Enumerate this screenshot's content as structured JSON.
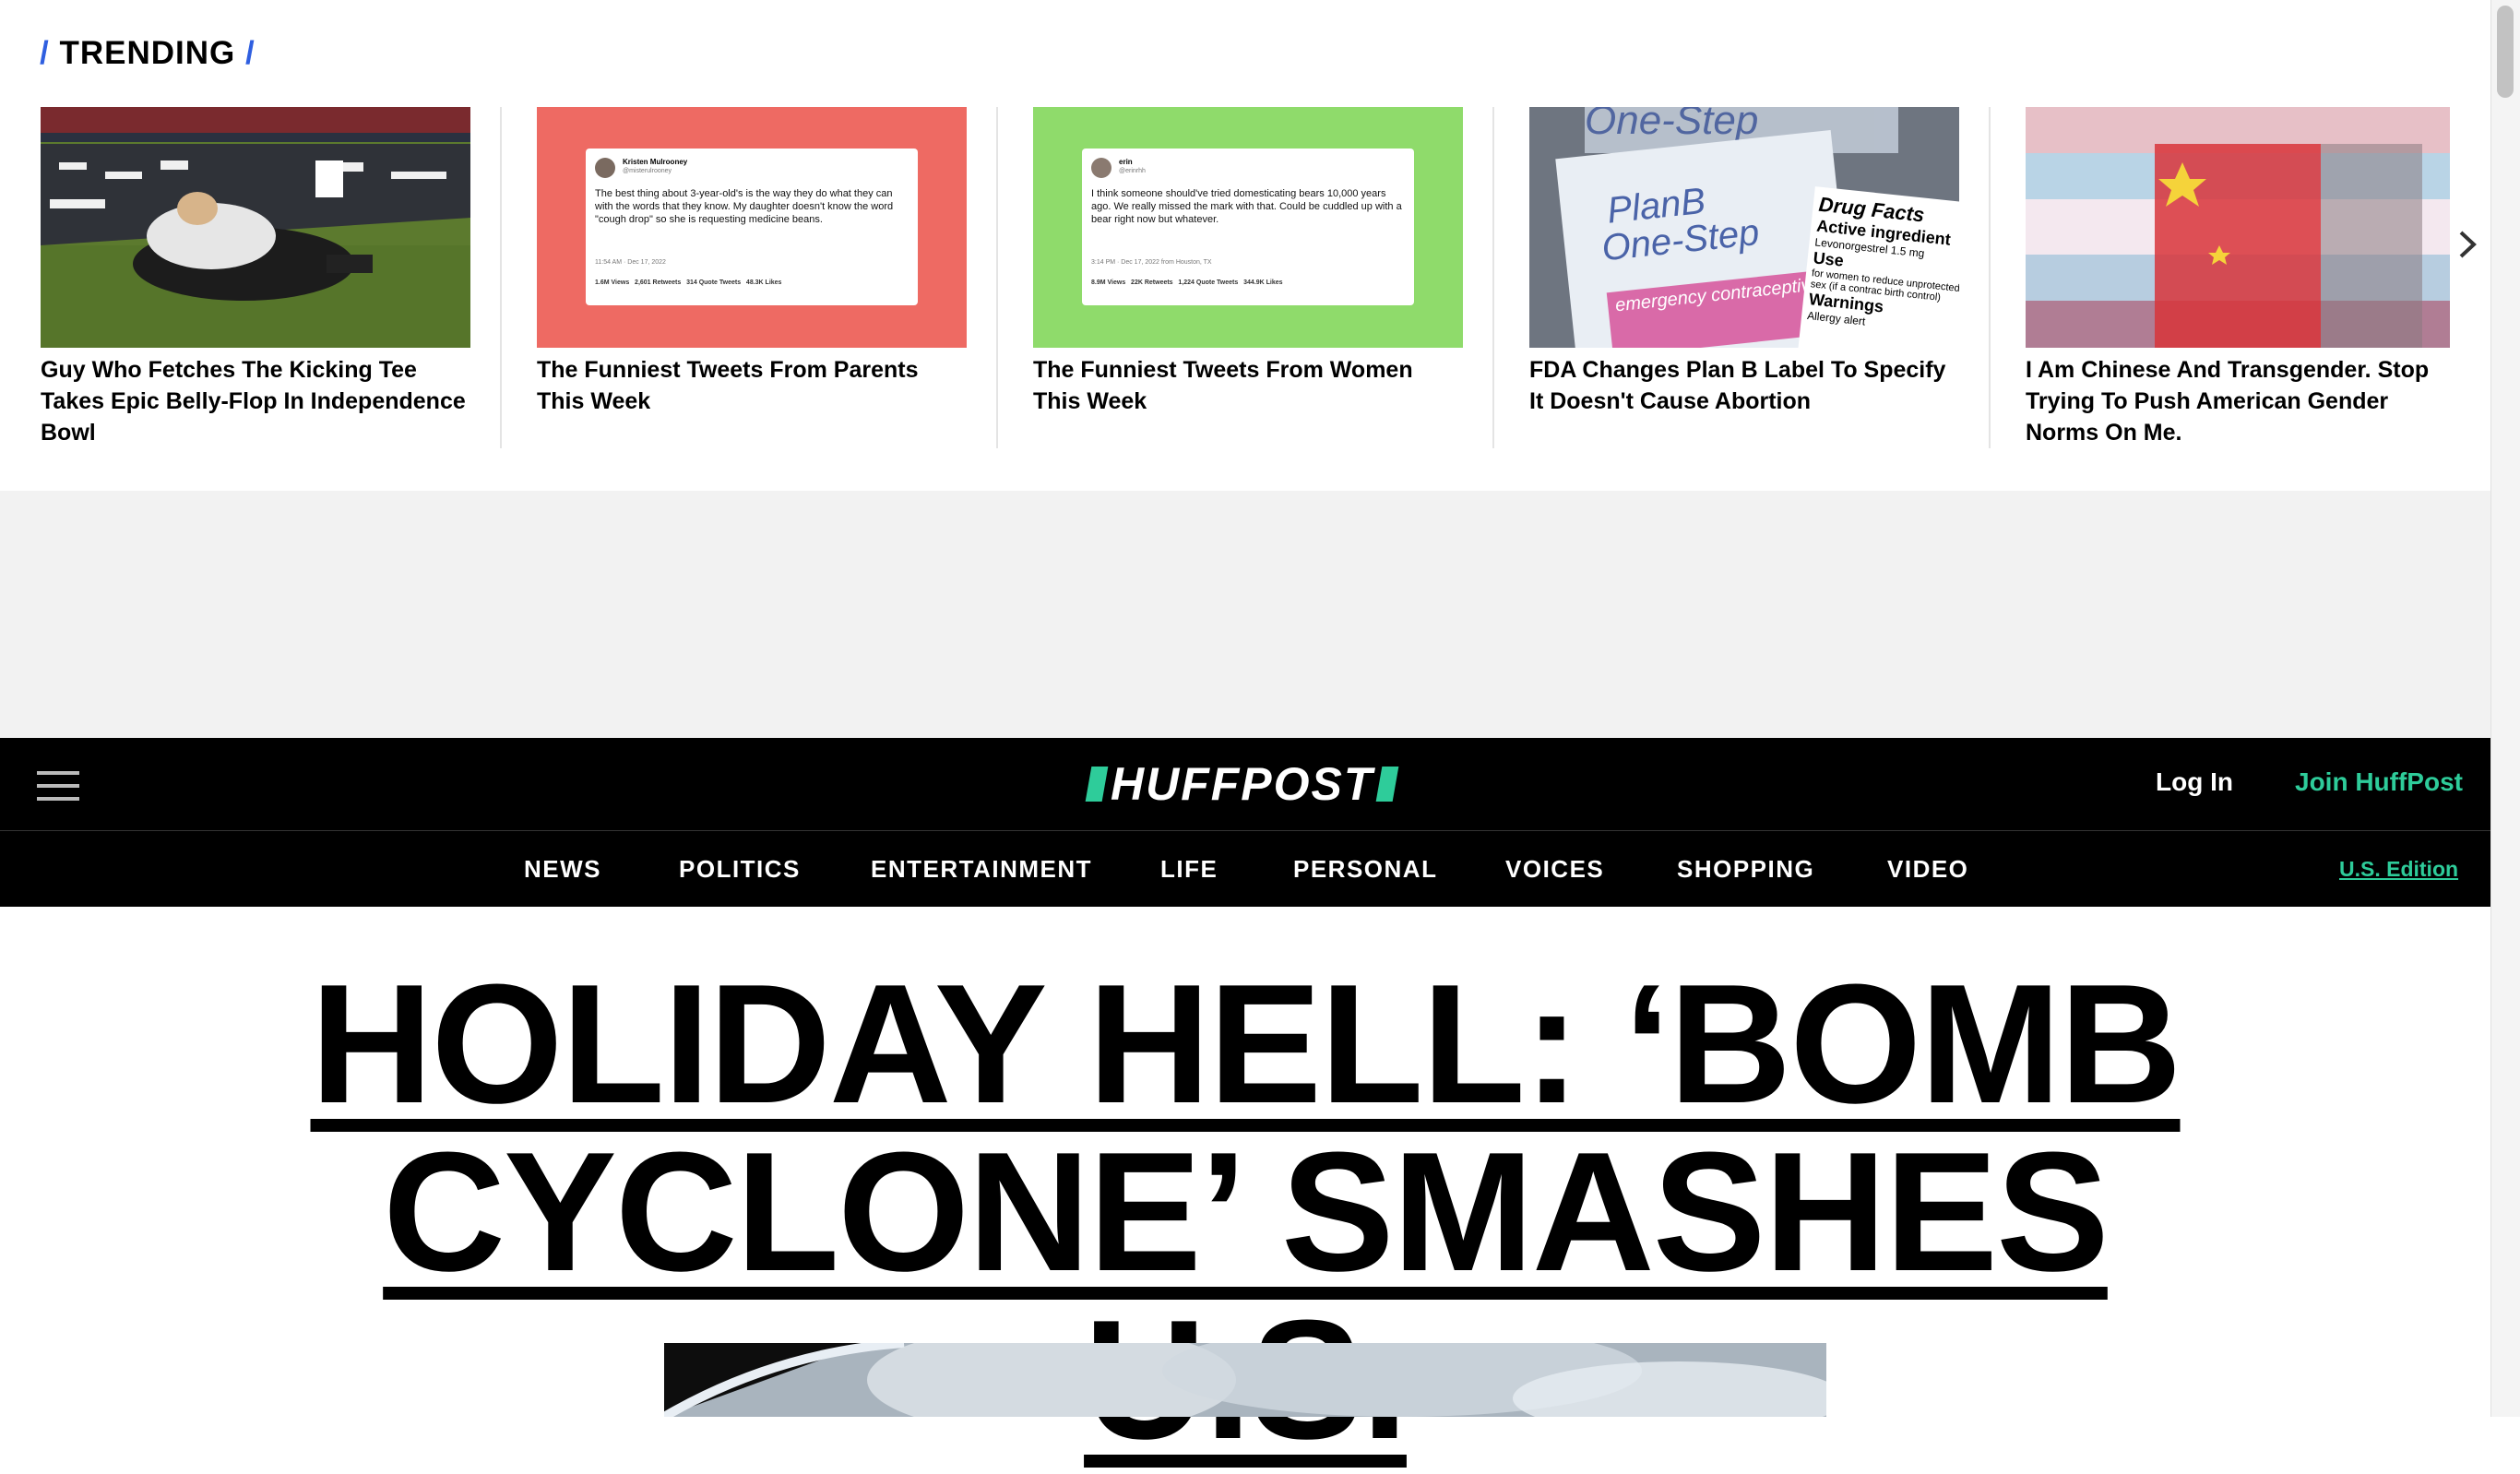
{
  "trending": {
    "title": "TRENDING",
    "items": [
      {
        "headline": "Guy Who Fetches The Kicking Tee Takes Epic Belly-Flop In Independence Bowl"
      },
      {
        "headline": "The Funniest Tweets From Parents This Week",
        "tweet": {
          "name": "Kristen Mulrooney",
          "handle": "@misterulrooney",
          "text": "The best thing about 3-year-old's is the way they do what they can with the words that they know. My daughter doesn't know the word \"cough drop\" so she is requesting medicine beans.",
          "meta": "11:54 AM · Dec 17, 2022",
          "stats": "1.6M Views   2,601 Retweets   314 Quote Tweets   48.3K Likes"
        }
      },
      {
        "headline": "The Funniest Tweets From Women This Week",
        "tweet": {
          "name": "erin",
          "handle": "@erinrhh",
          "text": "I think someone should've tried domesticating bears 10,000 years ago. We really missed the mark with that. Could be cuddled up with a bear right now but whatever.",
          "meta": "3:14 PM · Dec 17, 2022 from Houston, TX",
          "stats": "8.9M Views   22K Retweets   1,224 Quote Tweets   344.9K Likes"
        }
      },
      {
        "headline": "FDA Changes Plan B Label To Specify It Doesn't Cause Abortion",
        "box": {
          "brand_top": "One-Step",
          "brand1": "PlanB",
          "brand2": "One-Step",
          "sub": "emergency contraceptive",
          "facts_title": "Drug Facts",
          "facts_line1": "Active ingredient",
          "facts_line2": "Levonorgestrel 1.5 mg",
          "use_title": "Use",
          "use_text": "for women to reduce unprotected sex (if a contrac birth control)",
          "warnings": "Warnings",
          "allergy": "Allergy alert"
        }
      },
      {
        "headline": "I Am Chinese And Transgender. Stop Trying To Push American Gender Norms On Me."
      }
    ]
  },
  "header": {
    "logo": "HUFFPOST",
    "login": "Log In",
    "join": "Join HuffPost"
  },
  "nav": {
    "items": [
      "NEWS",
      "POLITICS",
      "ENTERTAINMENT",
      "LIFE",
      "PERSONAL",
      "VOICES",
      "SHOPPING",
      "VIDEO"
    ],
    "edition": "U.S. Edition"
  },
  "main": {
    "headline_line1": "HOLIDAY HELL: ‘BOMB",
    "headline_line2": "CYCLONE’ SMASHES U.S."
  },
  "colors": {
    "accent": "#2ecc9a",
    "trending_slash": "#2f5fe0",
    "card2_bg": "#ee6a63",
    "card3_bg": "#8fdb6b"
  }
}
